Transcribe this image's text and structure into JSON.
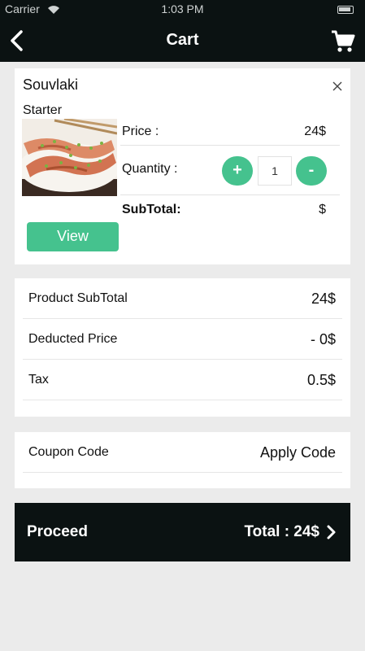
{
  "status_bar": {
    "carrier": "Carrier",
    "time": "1:03 PM"
  },
  "header": {
    "title": "Cart",
    "back_icon": "back-arrow-icon",
    "cart_icon": "shopping-cart-icon"
  },
  "item": {
    "name": "Souvlaki",
    "category": "Starter",
    "price_label": "Price :",
    "price_value": "24$",
    "quantity_label": "Quantity :",
    "quantity": "1",
    "plus": "+",
    "minus": "-",
    "subtotal_label": "SubTotal:",
    "subtotal_value": "$",
    "view_button": "View"
  },
  "summary": {
    "rows": [
      {
        "label": "Product SubTotal",
        "value": "24$"
      },
      {
        "label": "Deducted Price",
        "value": "- 0$"
      },
      {
        "label": "Tax",
        "value": "0.5$"
      }
    ]
  },
  "coupon": {
    "label": "Coupon Code",
    "action": "Apply Code"
  },
  "footer": {
    "proceed": "Proceed",
    "total": "Total : 24$"
  },
  "colors": {
    "accent": "#45c28e",
    "dark": "#0b1212",
    "background": "#ebebeb"
  }
}
